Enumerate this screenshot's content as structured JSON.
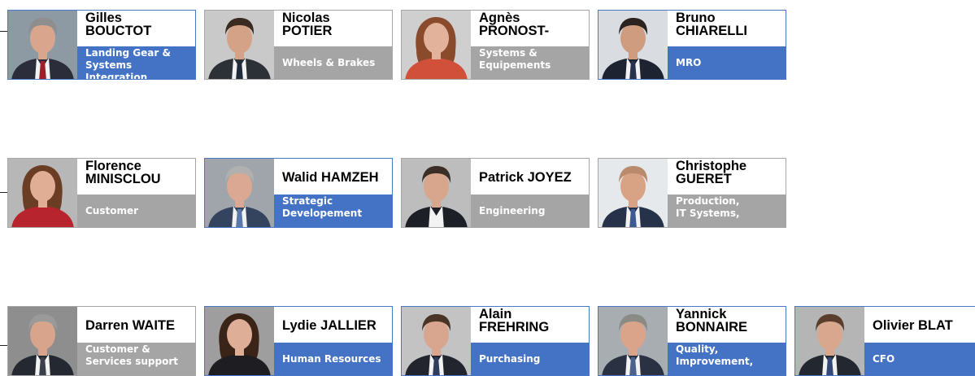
{
  "colors": {
    "blue": "#4472c4",
    "grey": "#a5a5a5"
  },
  "rows": [
    [
      {
        "name": "Gilles\nBOUCTOT",
        "role": "Landing Gear &\nSystems Integration",
        "role_color": "blue",
        "border": "blue",
        "photo": "man-grey-hair-red-tie"
      },
      {
        "name": "Nicolas\nPOTIER",
        "role": "Wheels & Brakes",
        "role_color": "grey",
        "border": "grey",
        "photo": "man-beard-dark-hair"
      },
      {
        "name": "Agnès\nPRONOST-",
        "role": "Systems &\nEquipements",
        "role_color": "grey",
        "border": "grey",
        "photo": "woman-auburn-hair"
      },
      {
        "name": "Bruno\nCHIARELLI",
        "role": "MRO",
        "role_color": "blue",
        "border": "blue",
        "photo": "man-dark-hair-smile"
      }
    ],
    [
      {
        "name": "Florence\nMINISCLOU",
        "role": "Customer",
        "role_color": "grey",
        "border": "grey",
        "photo": "woman-brown-hair-red-top"
      },
      {
        "name": "Walid HAMZEH",
        "role": "Strategic\nDevelopement",
        "role_color": "blue",
        "border": "blue",
        "photo": "man-grey-hair-blue-suit"
      },
      {
        "name": "Patrick JOYEZ",
        "role": "Engineering",
        "role_color": "grey",
        "border": "grey",
        "photo": "man-glasses-beard"
      },
      {
        "name": "Christophe\nGUERET",
        "role": "Production,\nIT Systems,",
        "role_color": "grey",
        "border": "grey",
        "photo": "man-bald-smile"
      }
    ],
    [
      {
        "name": "Darren WAITE",
        "role": "Customer &\nServices support",
        "role_color": "grey",
        "border": "grey",
        "photo": "man-short-grey-hair"
      },
      {
        "name": "Lydie JALLIER",
        "role": "Human Resources",
        "role_color": "blue",
        "border": "blue",
        "photo": "woman-long-dark-hair"
      },
      {
        "name": "Alain\nFREHRING",
        "role": "Purchasing",
        "role_color": "blue",
        "border": "blue",
        "photo": "man-dark-suit"
      },
      {
        "name": "Yannick\nBONNAIRE",
        "role": "Quality,\nImprovement,",
        "role_color": "blue",
        "border": "blue",
        "photo": "man-grey-hair-smile"
      },
      {
        "name": "Olivier BLAT",
        "role": "CFO",
        "role_color": "blue",
        "border": "blue",
        "photo": "man-short-brown-hair"
      }
    ]
  ]
}
